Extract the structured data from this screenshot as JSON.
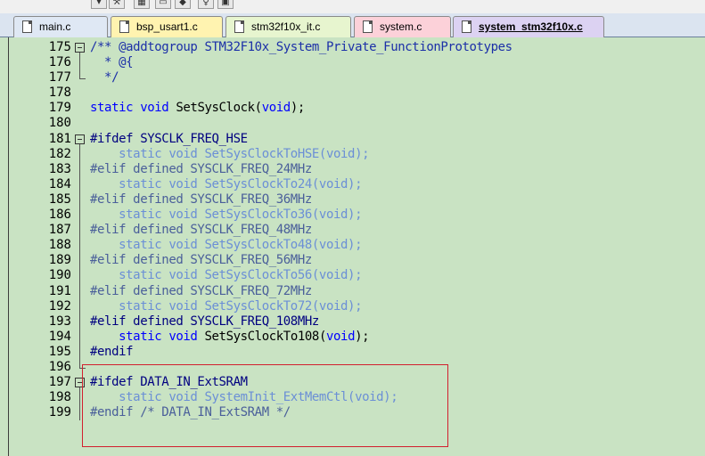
{
  "tabs": [
    {
      "label": "main.c",
      "bg": "#dfe8f4",
      "active": false
    },
    {
      "label": "bsp_usart1.c",
      "bg": "#fff3b0",
      "active": false
    },
    {
      "label": "stm32f10x_it.c",
      "bg": "#e7f5cf",
      "active": false
    },
    {
      "label": "system.c",
      "bg": "#fcd1d9",
      "active": false
    },
    {
      "label": "system_stm32f10x.c",
      "bg": "#dcd2f2",
      "active": true
    }
  ],
  "colors": {
    "editor_bg": "#c9e3c3",
    "highlight_box": "#d21f2e",
    "comment": "#1c30a8",
    "keyword": "#0000ff",
    "inactive_code": "#6b8fd6"
  },
  "code_lines": [
    {
      "num": "175",
      "fold": "start",
      "segments": [
        {
          "t": "/** @addtogroup STM32F10x_System_Private_FunctionPrototypes",
          "c": "comment"
        }
      ]
    },
    {
      "num": "176",
      "fold": "bar",
      "segments": [
        {
          "t": "  * @{",
          "c": "comment"
        }
      ]
    },
    {
      "num": "177",
      "fold": "end",
      "segments": [
        {
          "t": "  */",
          "c": "comment"
        }
      ]
    },
    {
      "num": "178",
      "fold": "",
      "segments": []
    },
    {
      "num": "179",
      "fold": "",
      "segments": [
        {
          "t": "static void ",
          "c": "kw"
        },
        {
          "t": "SetSysClock(",
          "c": "norm"
        },
        {
          "t": "void",
          "c": "kw"
        },
        {
          "t": ");",
          "c": "norm"
        }
      ]
    },
    {
      "num": "180",
      "fold": "",
      "segments": []
    },
    {
      "num": "181",
      "fold": "start",
      "segments": [
        {
          "t": "#ifdef SYSCLK_FREQ_HSE",
          "c": "pp"
        }
      ]
    },
    {
      "num": "182",
      "fold": "bar",
      "segments": [
        {
          "t": "    static void SetSysClockToHSE(void);",
          "c": "dim"
        }
      ]
    },
    {
      "num": "183",
      "fold": "bar",
      "segments": [
        {
          "t": "#elif defined SYSCLK_FREQ_24MHz",
          "c": "dimpp"
        }
      ]
    },
    {
      "num": "184",
      "fold": "bar",
      "segments": [
        {
          "t": "    static void SetSysClockTo24(void);",
          "c": "dim"
        }
      ]
    },
    {
      "num": "185",
      "fold": "bar",
      "segments": [
        {
          "t": "#elif defined SYSCLK_FREQ_36MHz",
          "c": "dimpp"
        }
      ]
    },
    {
      "num": "186",
      "fold": "bar",
      "segments": [
        {
          "t": "    static void SetSysClockTo36(void);",
          "c": "dim"
        }
      ]
    },
    {
      "num": "187",
      "fold": "bar",
      "segments": [
        {
          "t": "#elif defined SYSCLK_FREQ_48MHz",
          "c": "dimpp"
        }
      ]
    },
    {
      "num": "188",
      "fold": "bar",
      "segments": [
        {
          "t": "    static void SetSysClockTo48(void);",
          "c": "dim"
        }
      ]
    },
    {
      "num": "189",
      "fold": "bar",
      "segments": [
        {
          "t": "#elif defined SYSCLK_FREQ_56MHz",
          "c": "dimpp"
        }
      ]
    },
    {
      "num": "190",
      "fold": "bar",
      "segments": [
        {
          "t": "    static void SetSysClockTo56(void);",
          "c": "dim"
        }
      ]
    },
    {
      "num": "191",
      "fold": "bar",
      "segments": [
        {
          "t": "#elif defined SYSCLK_FREQ_72MHz",
          "c": "dimpp"
        }
      ]
    },
    {
      "num": "192",
      "fold": "bar",
      "segments": [
        {
          "t": "    static void SetSysClockTo72(void);",
          "c": "dim"
        }
      ]
    },
    {
      "num": "193",
      "fold": "bar",
      "segments": [
        {
          "t": "#elif defined SYSCLK_FREQ_108MHz",
          "c": "pp"
        }
      ]
    },
    {
      "num": "194",
      "fold": "bar",
      "segments": [
        {
          "t": "    ",
          "c": "norm"
        },
        {
          "t": "static void ",
          "c": "kw"
        },
        {
          "t": "SetSysClockTo108(",
          "c": "norm"
        },
        {
          "t": "void",
          "c": "kw"
        },
        {
          "t": ");",
          "c": "norm"
        }
      ]
    },
    {
      "num": "195",
      "fold": "bar",
      "segments": [
        {
          "t": "#endif",
          "c": "pp"
        }
      ]
    },
    {
      "num": "196",
      "fold": "end",
      "segments": []
    },
    {
      "num": "197",
      "fold": "start",
      "segments": [
        {
          "t": "#ifdef DATA_IN_ExtSRAM",
          "c": "pp"
        }
      ]
    },
    {
      "num": "198",
      "fold": "bar",
      "segments": [
        {
          "t": "    static void SystemInit_ExtMemCtl(void);",
          "c": "dim"
        }
      ]
    },
    {
      "num": "199",
      "fold": "bar",
      "segments": [
        {
          "t": "#endif /* DATA_IN_ExtSRAM */",
          "c": "dimpp"
        }
      ]
    }
  ]
}
